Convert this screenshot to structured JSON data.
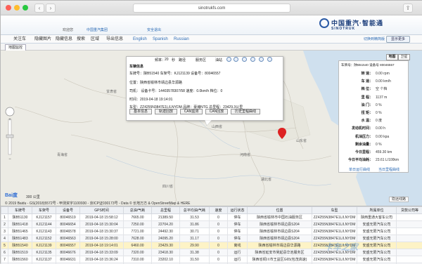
{
  "browser": {
    "url": "sinotrukfs.com"
  },
  "header": {
    "welcome": "欢迎您",
    "link1": "中国重汽集团",
    "link2": "安全退出",
    "logo_cn": "中国重汽·智能通",
    "logo_en": "SINOTRUK"
  },
  "nav": {
    "items": [
      "关注车",
      "隐藏图片",
      "隐藏信息",
      "搜索",
      "区域",
      "导出信息"
    ],
    "langs": [
      "English",
      "Spanish",
      "Russian"
    ],
    "plane_label": "切换到精简版",
    "exit_label": "显示更多"
  },
  "tab": {
    "label": "地图监控"
  },
  "popup": {
    "freq_label": "频率：",
    "freq_value": "20",
    "freq_unit": "秒",
    "opt1": "路径",
    "opt2": "服务区",
    "opt3": "油站",
    "title": "车辆信息",
    "plate_line": "车牌号：陕B51540  车架号：KJ121139  设备号：80046557",
    "location_line": "位置：陕西省榆林市靖边县华源路",
    "driver_line": "司机：  设备卡号：14403578307/58  速度：0.0km/h  档位：0",
    "time_line": "时间：2019-04-18 19:14:01",
    "model_line": "车型：ZZ4255N3847E1L/LNYDM  品牌：豪瀚NTG  总里程：23429.3公里",
    "buttons": [
      "基本信息",
      "轨迹回放",
      "CAN监测",
      "CAN回放",
      "历史里程曲线"
    ]
  },
  "map": {
    "type_buttons": [
      "地图",
      "卫星"
    ],
    "scale": "300 公里",
    "copyright": "© 2019 Baidu - GS(2018)5572号 - 甲测资字1100930 - 京ICP证030173号 - Data © 长地万方 & OpenStreetMap & HERE",
    "route_label": "隐远线路",
    "baidu": "Bai度"
  },
  "right_panel": {
    "title": "车牌号：陕B51540  设备号 80046557",
    "rows": [
      {
        "k": "转  速：",
        "v": "0.00 rpm"
      },
      {
        "k": "车  速：",
        "v": "0.00 km/h"
      },
      {
        "k": "档  位：",
        "v": "空 个档"
      },
      {
        "k": "里  程：",
        "v": "1137 m"
      },
      {
        "k": "油  门：",
        "v": "0 %"
      },
      {
        "k": "扭  矩：",
        "v": "0 %"
      },
      {
        "k": "水  温：",
        "v": "0 度"
      },
      {
        "k": "发动机时间：",
        "v": "0.00 h"
      },
      {
        "k": "机油压力：",
        "v": "0.00 kpa"
      },
      {
        "k": "剩余油量：",
        "v": "0 %"
      },
      {
        "k": "今日里程：",
        "v": "459.30 km"
      },
      {
        "k": "今日平均油耗：",
        "v": "23.61 L/100km"
      }
    ],
    "link1": "单日运行曲线",
    "link2": "当日里程曲线"
  },
  "table": {
    "headers": [
      "",
      "车牌号",
      "车架号",
      "设备号",
      "GPS时间",
      "总油/气耗",
      "总里程",
      "总平均油/气耗",
      "速度",
      "运行状态",
      "位置",
      "车型",
      "所属单位",
      "贷款公司等"
    ],
    "rows": [
      [
        "1",
        "陕B51130",
        "KJ121157",
        "80046519",
        "2019-04-18 15:58:12",
        "7665.00",
        "21389.50",
        "31.53",
        "0",
        "停车",
        "陕西省榆林市中国石油服务区",
        "ZZ4255N3847E1L/LNYDM",
        "陕西重通大客车公司",
        ""
      ],
      [
        "2",
        "陕B51418",
        "KJ121144",
        "80046654",
        "2019-04-18 15:30:04",
        "7250.00",
        "22704.20",
        "31.86",
        "0",
        "停车",
        "陕西省榆林市靖边县S204",
        "ZZ4255N3847E1L/LNYDM",
        "安盛无限汽车公司",
        ""
      ],
      [
        "3",
        "陕B51465",
        "KJ121143",
        "80046578",
        "2019-04-18 15:30:37",
        "7721.00",
        "24492.30",
        "30.71",
        "0",
        "停车",
        "陕西省榆林市靖边县S204",
        "ZZ4255N3847E1L/LNYDM",
        "安盛无限汽车公司",
        ""
      ],
      [
        "4",
        "陕B51483",
        "KJ121152",
        "80046563",
        "2019-04-18 15:28:00",
        "7628.00",
        "24095.20",
        "31.17",
        "0",
        "停车",
        "陕西省榆林市靖边县S204",
        "ZZ4255N3847E1L/LNYDM",
        "安盛无限汽车公司",
        ""
      ],
      [
        "5",
        "陕B51540",
        "KJ121139",
        "80046557",
        "2019-04-18 19:14:01",
        "6460.00",
        "23429.30",
        "29.90",
        "0",
        "离线",
        "陕西省榆林市靖边县华源路",
        "ZZ4255N3847E1L/LNYDM",
        "安盛无限汽车公司",
        ""
      ],
      [
        "6",
        "陕B51519",
        "KJ121135",
        "80046676",
        "2019-04-18 15:33:09",
        "7320.00",
        "23418.30",
        "31.38",
        "0",
        "运行",
        "陕西省延安市吴起县华池服务区",
        "ZZ4255N3847E1L/LNYDM",
        "安盛无限汽车公司",
        ""
      ],
      [
        "7",
        "陕B51560",
        "KJ121137",
        "80046631",
        "2019-04-18 15:36:24",
        "7310.00",
        "23202.10",
        "31.50",
        "0",
        "运行",
        "陕西省铜川市王益区G65(包茂高速)",
        "ZZ4255N3847E1L/LNYDM",
        "安盛无限汽车公司",
        ""
      ],
      [
        "8",
        "陕B51549",
        "KJ121140",
        "80046539",
        "2019-04-18 15:36:40",
        "7260.00",
        "23024.20",
        "31.66",
        "0",
        "运行",
        "陕西省铜川市王益区G65(包茂高速)",
        "ZZ4255N3847E1L/LNYDM",
        "安盛无限汽车公司",
        ""
      ]
    ],
    "selected_index": 4
  },
  "watermark": "卡车之家"
}
